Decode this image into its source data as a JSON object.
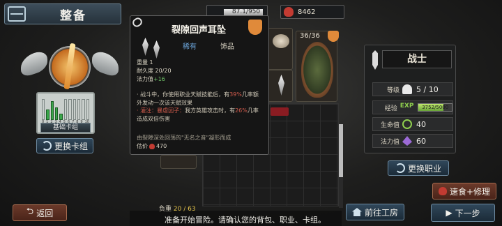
{
  "header": {
    "title": "整备"
  },
  "deck": {
    "label": "基础卡组",
    "swap_button": "更换卡组",
    "cost_curve": [
      {
        "cost": "0",
        "fill": 0
      },
      {
        "cost": "1",
        "fill": 0.5
      },
      {
        "cost": "2",
        "fill": 0.9
      },
      {
        "cost": "3",
        "fill": 0.6
      },
      {
        "cost": "4",
        "fill": 0.3
      },
      {
        "cost": "5",
        "fill": 0
      },
      {
        "cost": "6",
        "fill": 0
      },
      {
        "cost": "7",
        "fill": 0
      },
      {
        "cost": "8",
        "fill": 0
      },
      {
        "cost": "9",
        "fill": 0
      },
      {
        "cost": "10",
        "fill": 0
      }
    ]
  },
  "resources": {
    "hp": "87.1/950",
    "gold": "8462"
  },
  "inventory": {
    "shield_count": "36/36",
    "weight_label": "负重",
    "weight_value": "20 / 63"
  },
  "tooltip": {
    "name": "裂隙回声耳坠",
    "rarity": "稀有",
    "slot": "饰品",
    "stats": [
      "重量 1",
      "耐久度 20/20"
    ],
    "mana_label": "法力值",
    "mana_value": "+16",
    "desc1_a": "· 战斗中，你使用职业天赋技能后，有",
    "desc1_pct": "39%",
    "desc1_b": "几率额外发动一次该天赋效果",
    "desc2_tag": "· 灌注：暴虐因子：",
    "desc2_a": "我方英雄攻击时，有",
    "desc2_pct": "26%",
    "desc2_b": "几率造成双倍伤害",
    "source": "由裂隙深处回荡的\"无名之音\"凝形而成",
    "price_label": "估价",
    "price_value": "470"
  },
  "hero": {
    "name": "战士",
    "level_label": "等级",
    "level_value": "5 / 10",
    "exp_label": "经验",
    "exp_value": "3752/5000",
    "exp_fraction": 0.75,
    "hp_label": "生命值",
    "hp_value": "40",
    "mp_label": "法力值",
    "mp_value": "60",
    "change_button": "更换职业"
  },
  "buttons": {
    "back": "返回",
    "workshop": "前往工房",
    "next": "下一步",
    "quick_buy": "速食+修理"
  },
  "status": "准备开始冒险。请确认您的背包、职业、卡组。",
  "colors": {
    "accent_blue": "#30475a",
    "accent_brown": "#6b3a2a",
    "rarity_blue": "#6aa3d8",
    "highlight_red": "#d05b4c",
    "exp_green": "#8fcf4e"
  }
}
